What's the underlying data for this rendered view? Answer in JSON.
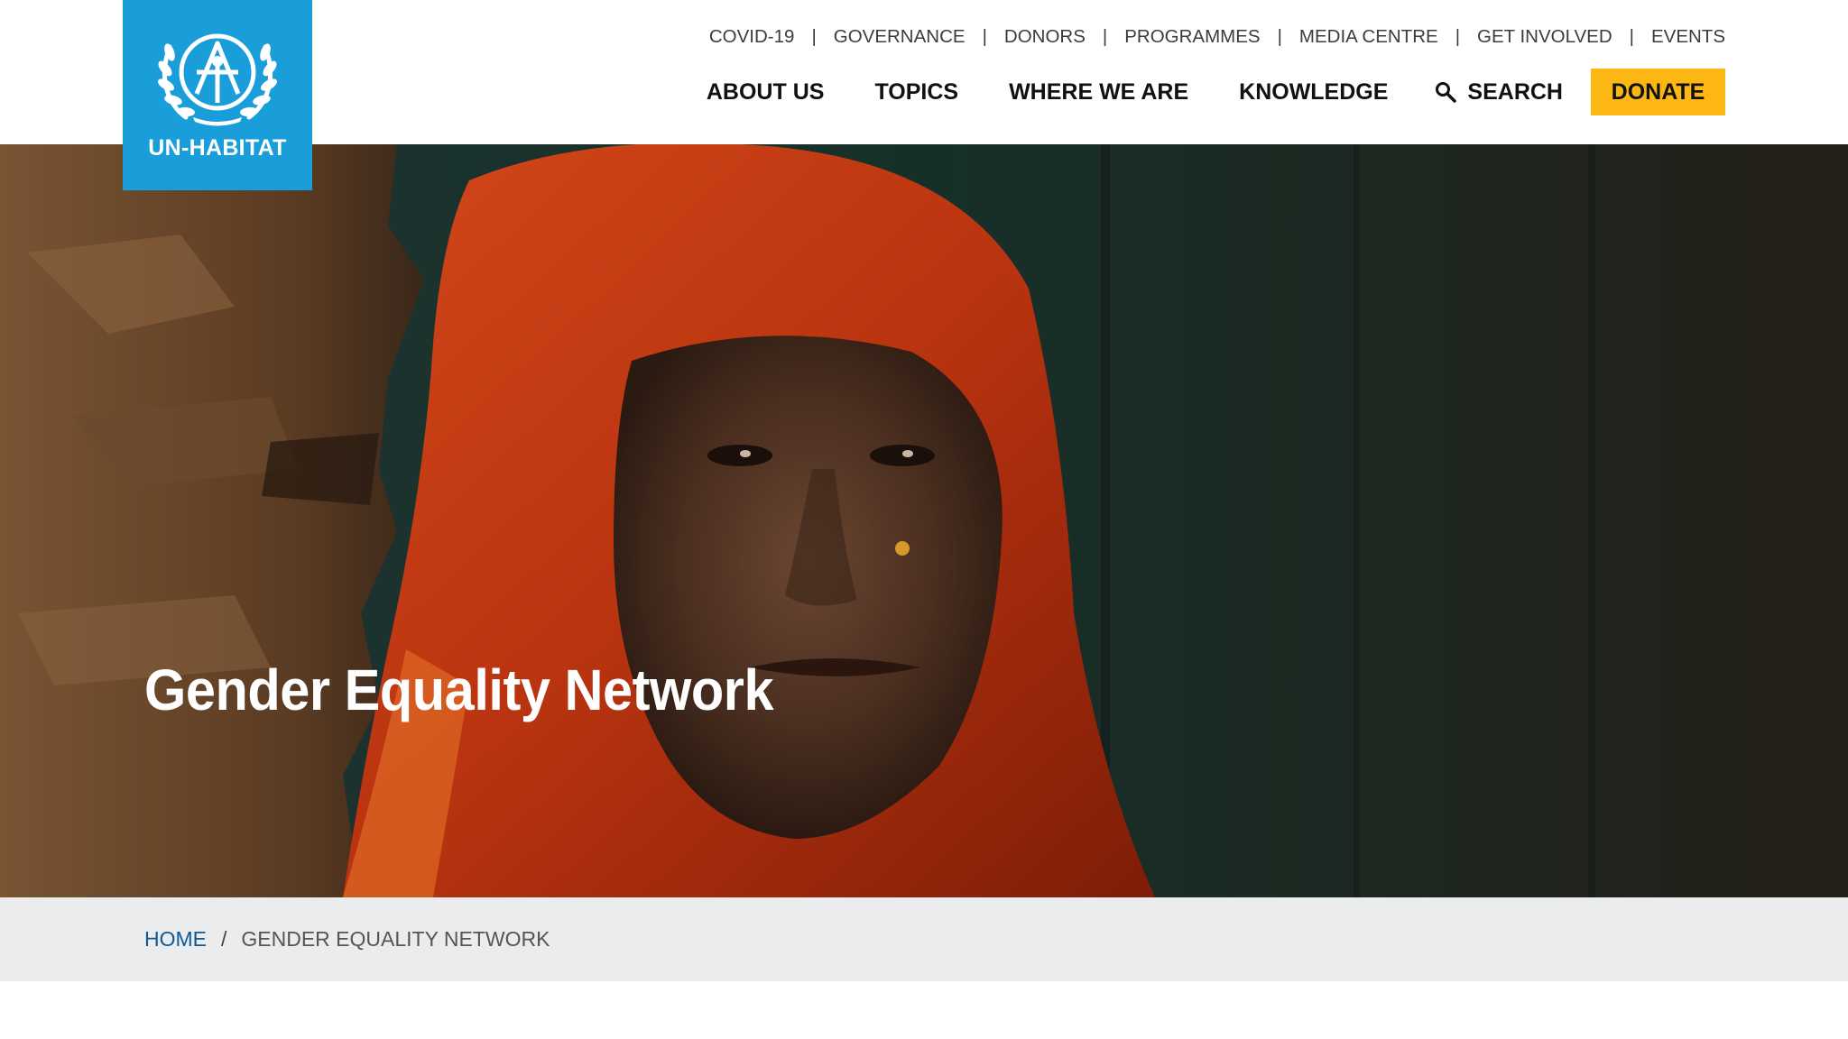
{
  "logo": {
    "text": "UN-HABITAT",
    "color": "#1a9ed9"
  },
  "utility_nav": [
    {
      "label": "COVID-19"
    },
    {
      "label": "GOVERNANCE"
    },
    {
      "label": "DONORS"
    },
    {
      "label": "PROGRAMMES"
    },
    {
      "label": "MEDIA CENTRE"
    },
    {
      "label": "GET INVOLVED"
    },
    {
      "label": "EVENTS"
    }
  ],
  "utility_separator": "|",
  "main_nav": [
    {
      "label": "ABOUT US"
    },
    {
      "label": "TOPICS"
    },
    {
      "label": "WHERE WE ARE"
    },
    {
      "label": "KNOWLEDGE"
    }
  ],
  "search": {
    "label": "SEARCH",
    "icon": "search-icon"
  },
  "donate": {
    "label": "DONATE",
    "color": "#fdb714"
  },
  "hero": {
    "title": "Gender Equality Network"
  },
  "breadcrumb": {
    "home": "HOME",
    "separator": "/",
    "current": "GENDER EQUALITY NETWORK",
    "link_color": "#0f5a96"
  }
}
